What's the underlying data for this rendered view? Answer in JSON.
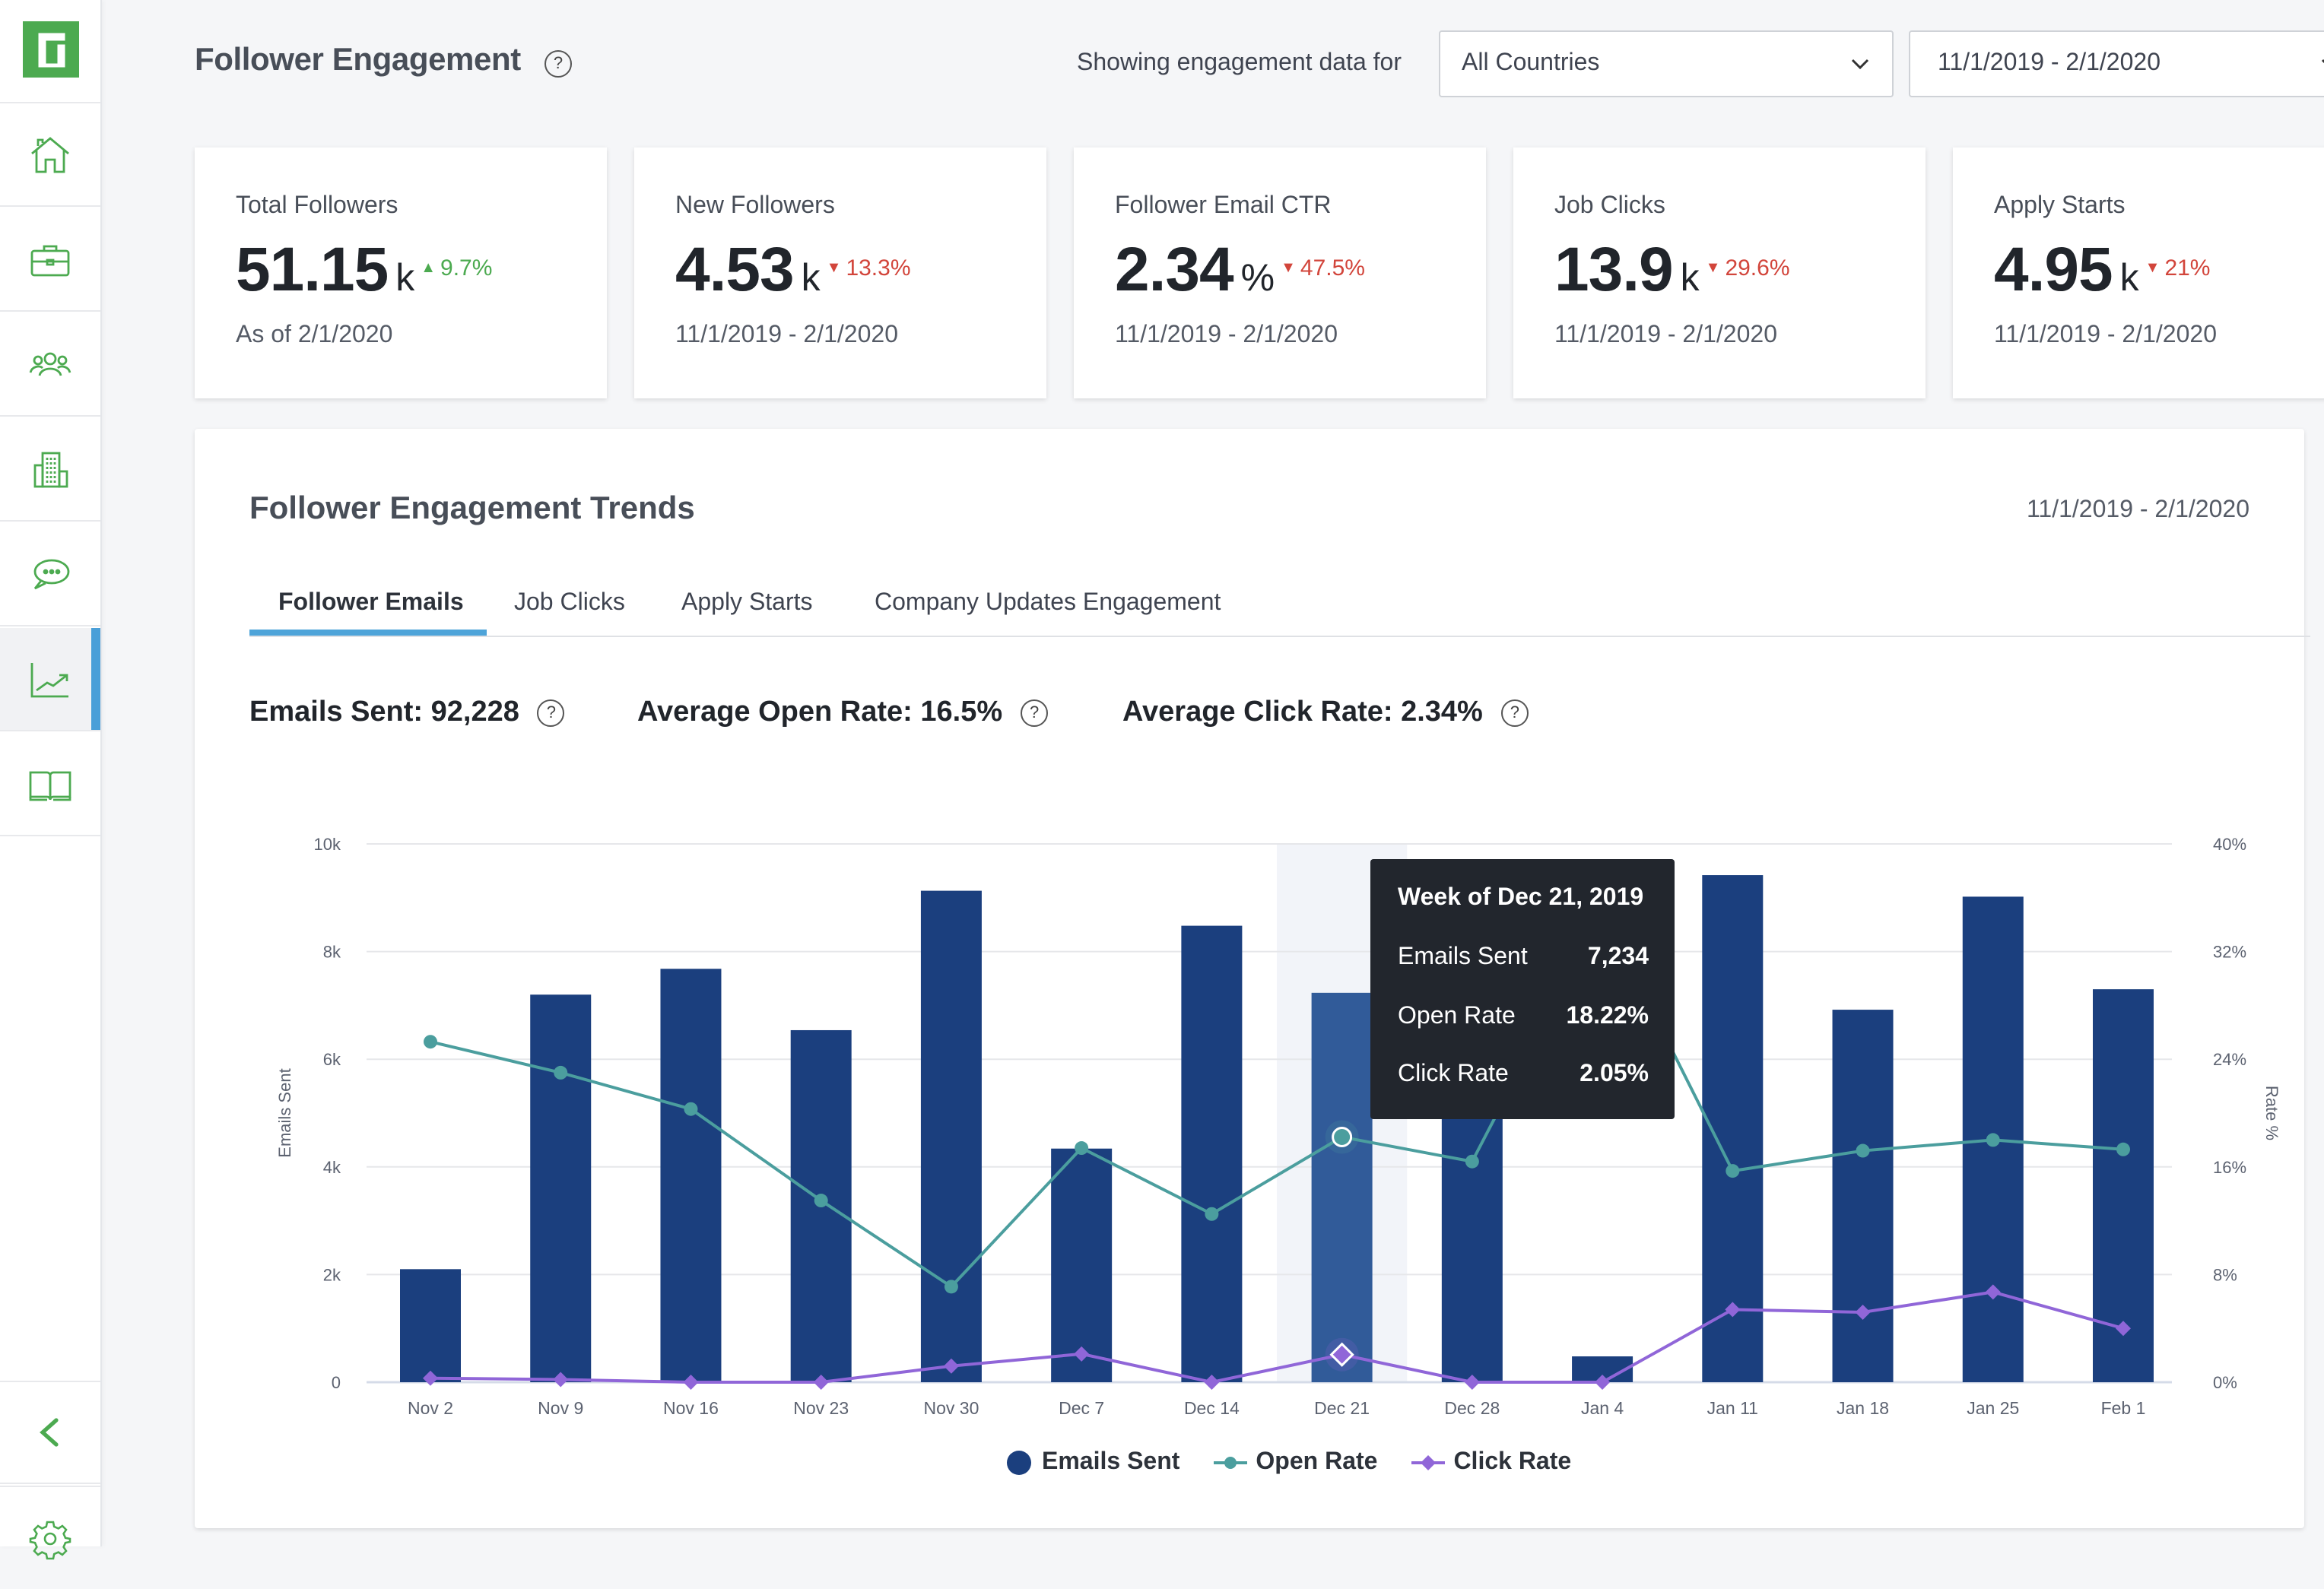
{
  "sidebar": {
    "logo": "glassdoor-logo",
    "items": [
      {
        "name": "home",
        "icon": "home-icon",
        "active": false
      },
      {
        "name": "jobs",
        "icon": "briefcase-icon",
        "active": false
      },
      {
        "name": "followers",
        "icon": "people-icon",
        "active": false
      },
      {
        "name": "company",
        "icon": "building-icon",
        "active": false
      },
      {
        "name": "reviews",
        "icon": "chat-bubble-icon",
        "active": false
      },
      {
        "name": "analytics",
        "icon": "trend-chart-icon",
        "active": true
      },
      {
        "name": "resources",
        "icon": "book-icon",
        "active": false
      }
    ],
    "bottom": [
      {
        "name": "collapse",
        "icon": "chevron-left-icon"
      },
      {
        "name": "settings",
        "icon": "gear-icon"
      }
    ]
  },
  "header": {
    "title": "Follower Engagement",
    "filter_label": "Showing engagement data for",
    "country_select": "All Countries",
    "date_select": "11/1/2019 - 2/1/2020"
  },
  "kpis": [
    {
      "label": "Total Followers",
      "value": "51.15",
      "unit": "k",
      "delta": "9.7%",
      "direction": "up",
      "sub": "As of 2/1/2020"
    },
    {
      "label": "New Followers",
      "value": "4.53",
      "unit": "k",
      "delta": "13.3%",
      "direction": "down",
      "sub": "11/1/2019 - 2/1/2020"
    },
    {
      "label": "Follower Email CTR",
      "value": "2.34",
      "unit": "%",
      "delta": "47.5%",
      "direction": "down",
      "sub": "11/1/2019 - 2/1/2020"
    },
    {
      "label": "Job Clicks",
      "value": "13.9",
      "unit": "k",
      "delta": "29.6%",
      "direction": "down",
      "sub": "11/1/2019 - 2/1/2020"
    },
    {
      "label": "Apply Starts",
      "value": "4.95",
      "unit": "k",
      "delta": "21%",
      "direction": "down",
      "sub": "11/1/2019 - 2/1/2020"
    }
  ],
  "trends": {
    "title": "Follower Engagement Trends",
    "date_range": "11/1/2019 - 2/1/2020",
    "tabs": [
      {
        "label": "Follower Emails",
        "active": true
      },
      {
        "label": "Job Clicks",
        "active": false
      },
      {
        "label": "Apply Starts",
        "active": false
      },
      {
        "label": "Company Updates Engagement",
        "active": false
      }
    ],
    "stats": [
      {
        "label": "Emails Sent: 92,228"
      },
      {
        "label": "Average Open Rate: 16.5%"
      },
      {
        "label": "Average Click Rate: 2.34%"
      }
    ],
    "tooltip": {
      "title": "Week of Dec 21, 2019",
      "rows": [
        {
          "label": "Emails Sent",
          "value": "7,234"
        },
        {
          "label": "Open Rate",
          "value": "18.22%"
        },
        {
          "label": "Click Rate",
          "value": "2.05%"
        }
      ]
    }
  },
  "colors": {
    "bar": "#1b3f7e",
    "bar_hover": "#315b99",
    "open_rate": "#4b9e9e",
    "click_rate": "#9066d8",
    "brand_green": "#4caa50",
    "accent_blue": "#4ea4d9",
    "up": "#4caa50",
    "down": "#d2453b"
  },
  "chart_data": {
    "type": "bar",
    "title": "",
    "xlabel": "",
    "ylabel": "Emails Sent",
    "y2label": "Rate %",
    "categories": [
      "Nov 2",
      "Nov 9",
      "Nov 16",
      "Nov 23",
      "Nov 30",
      "Dec 7",
      "Dec 14",
      "Dec 21",
      "Dec 28",
      "Jan 4",
      "Jan 11",
      "Jan 18",
      "Jan 25",
      "Feb 1"
    ],
    "ylim": [
      0,
      10000
    ],
    "y2lim": [
      0,
      40
    ],
    "yticks": [
      "0",
      "2k",
      "4k",
      "6k",
      "8k",
      "10k"
    ],
    "y2ticks": [
      "0%",
      "8%",
      "16%",
      "24%",
      "32%",
      "40%"
    ],
    "grid": true,
    "legend_position": "bottom-center",
    "highlighted_category": "Dec 21",
    "series": [
      {
        "name": "Emails Sent",
        "type": "bar",
        "axis": "left",
        "values": [
          2100,
          7200,
          7680,
          6540,
          9130,
          4340,
          8480,
          7234,
          6000,
          480,
          9420,
          6920,
          9020,
          7300
        ]
      },
      {
        "name": "Open Rate",
        "type": "line",
        "axis": "right",
        "marker": "circle",
        "values": [
          25.3,
          23.0,
          20.3,
          13.5,
          7.1,
          17.4,
          12.5,
          18.22,
          16.4,
          35.0,
          15.7,
          17.2,
          18.0,
          17.3
        ]
      },
      {
        "name": "Click Rate",
        "type": "line",
        "axis": "right",
        "marker": "diamond",
        "values": [
          0.3,
          0.2,
          0.0,
          0.0,
          1.2,
          2.1,
          0.0,
          2.05,
          0.0,
          0.0,
          5.4,
          5.2,
          6.7,
          4.0
        ]
      }
    ]
  }
}
